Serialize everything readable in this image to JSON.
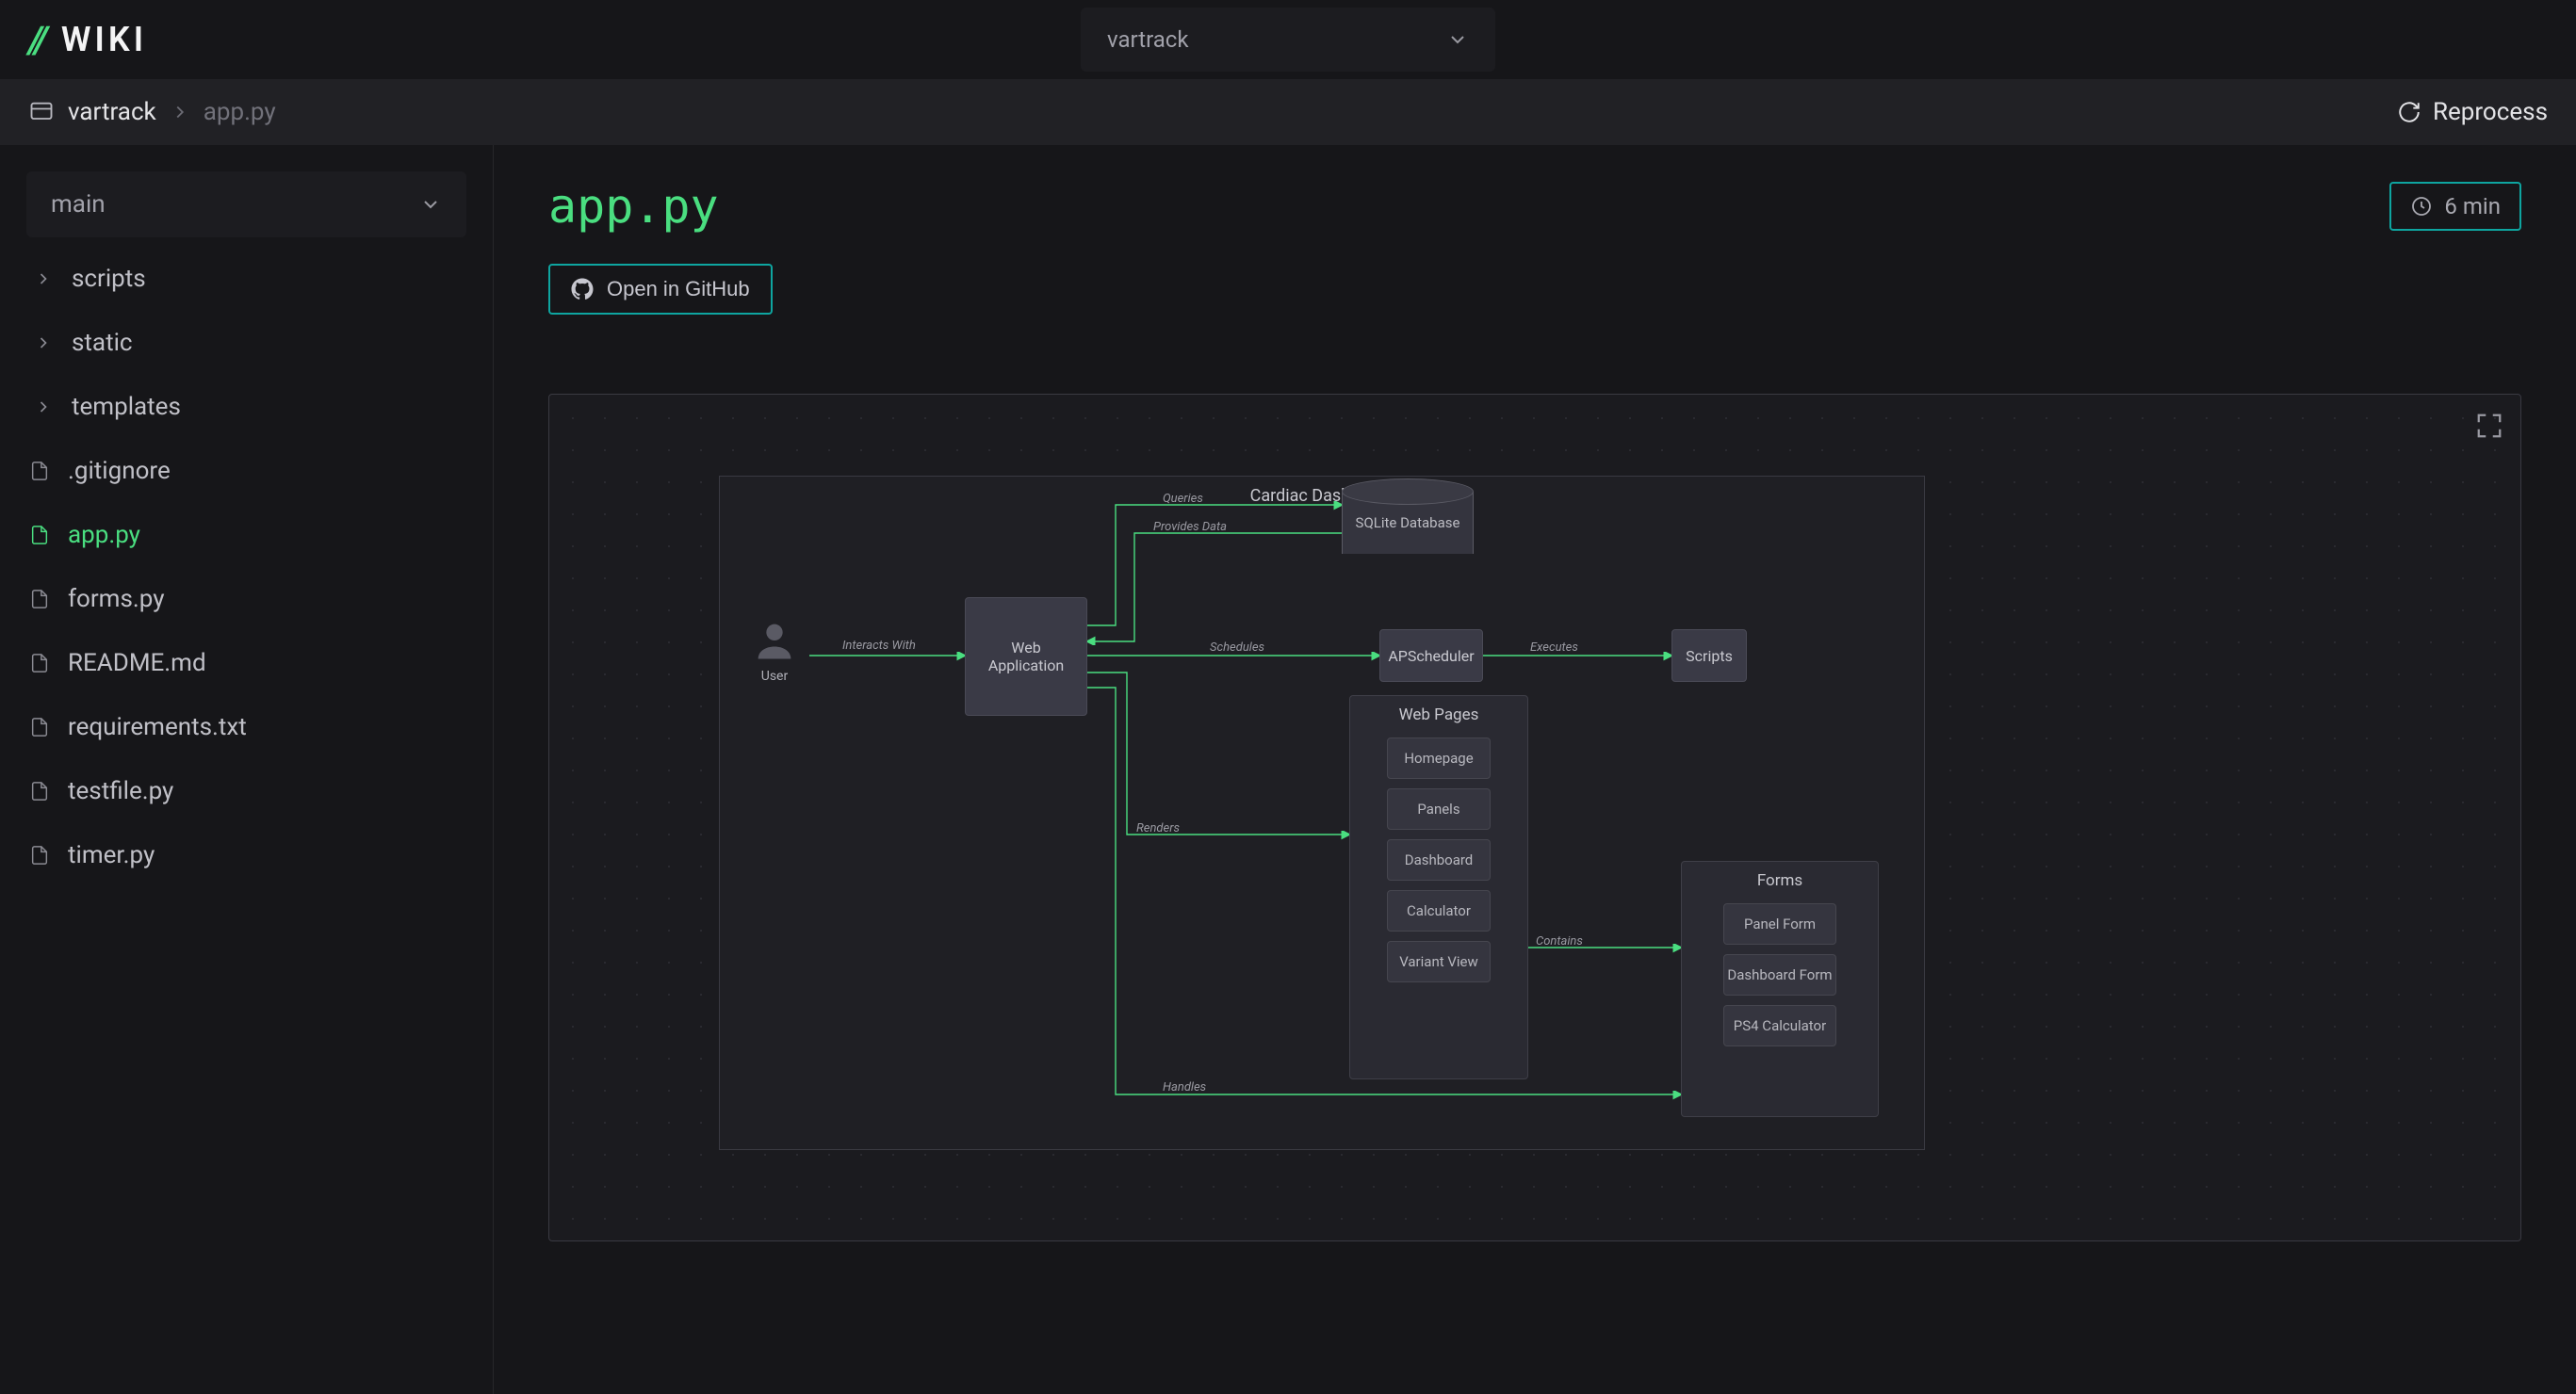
{
  "header": {
    "logo_text": "WIKI",
    "repo_selected": "vartrack"
  },
  "breadcrumb": {
    "repo": "vartrack",
    "file": "app.py",
    "reprocess_label": "Reprocess"
  },
  "sidebar": {
    "branch": "main",
    "folders": [
      "scripts",
      "static",
      "templates"
    ],
    "files": [
      ".gitignore",
      "app.py",
      "forms.py",
      "README.md",
      "requirements.txt",
      "testfile.py",
      "timer.py"
    ],
    "active_file": "app.py"
  },
  "main": {
    "title": "app.py",
    "read_time": "6 min",
    "github_label": "Open in GitHub"
  },
  "diagram": {
    "frame_title": "Cardiac Dashboard",
    "user_label": "User",
    "web_app_label": "Web Application",
    "db_label": "SQLite Database",
    "scheduler_label": "APScheduler",
    "scripts_label": "Scripts",
    "web_pages_group": {
      "title": "Web Pages",
      "items": [
        "Homepage",
        "Panels",
        "Dashboard",
        "Calculator",
        "Variant View"
      ]
    },
    "forms_group": {
      "title": "Forms",
      "items": [
        "Panel Form",
        "Dashboard Form",
        "PS4 Calculator"
      ]
    },
    "edges": {
      "interacts": "Interacts With",
      "queries": "Queries",
      "provides": "Provides Data",
      "schedules": "Schedules",
      "executes": "Executes",
      "renders": "Renders",
      "contains": "Contains",
      "handles": "Handles"
    }
  }
}
